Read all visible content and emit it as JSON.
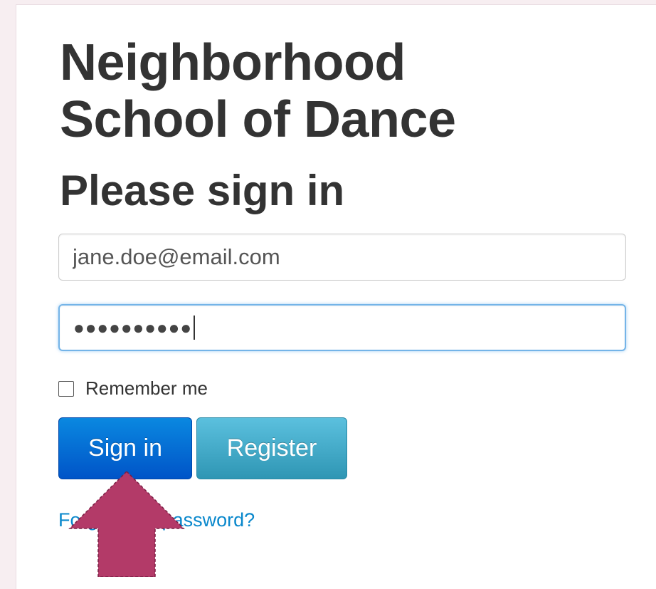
{
  "school_name_line1": "Neighborhood",
  "school_name_line2": "School of Dance",
  "heading": "Please sign in",
  "email": {
    "value": "jane.doe@email.com"
  },
  "password": {
    "masked_value": "●●●●●●●●●●"
  },
  "remember_me": {
    "label": "Remember me",
    "checked": false
  },
  "buttons": {
    "sign_in": "Sign in",
    "register": "Register"
  },
  "forgot_password_link": "Forgot your password?",
  "colors": {
    "sign_in_button": "#0066cc",
    "register_button": "#49afcd",
    "link": "#0a88cc",
    "annotation_arrow": "#b33a68",
    "focus_border": "#74b4e8"
  },
  "annotation": {
    "icon": "up-arrow-icon"
  }
}
